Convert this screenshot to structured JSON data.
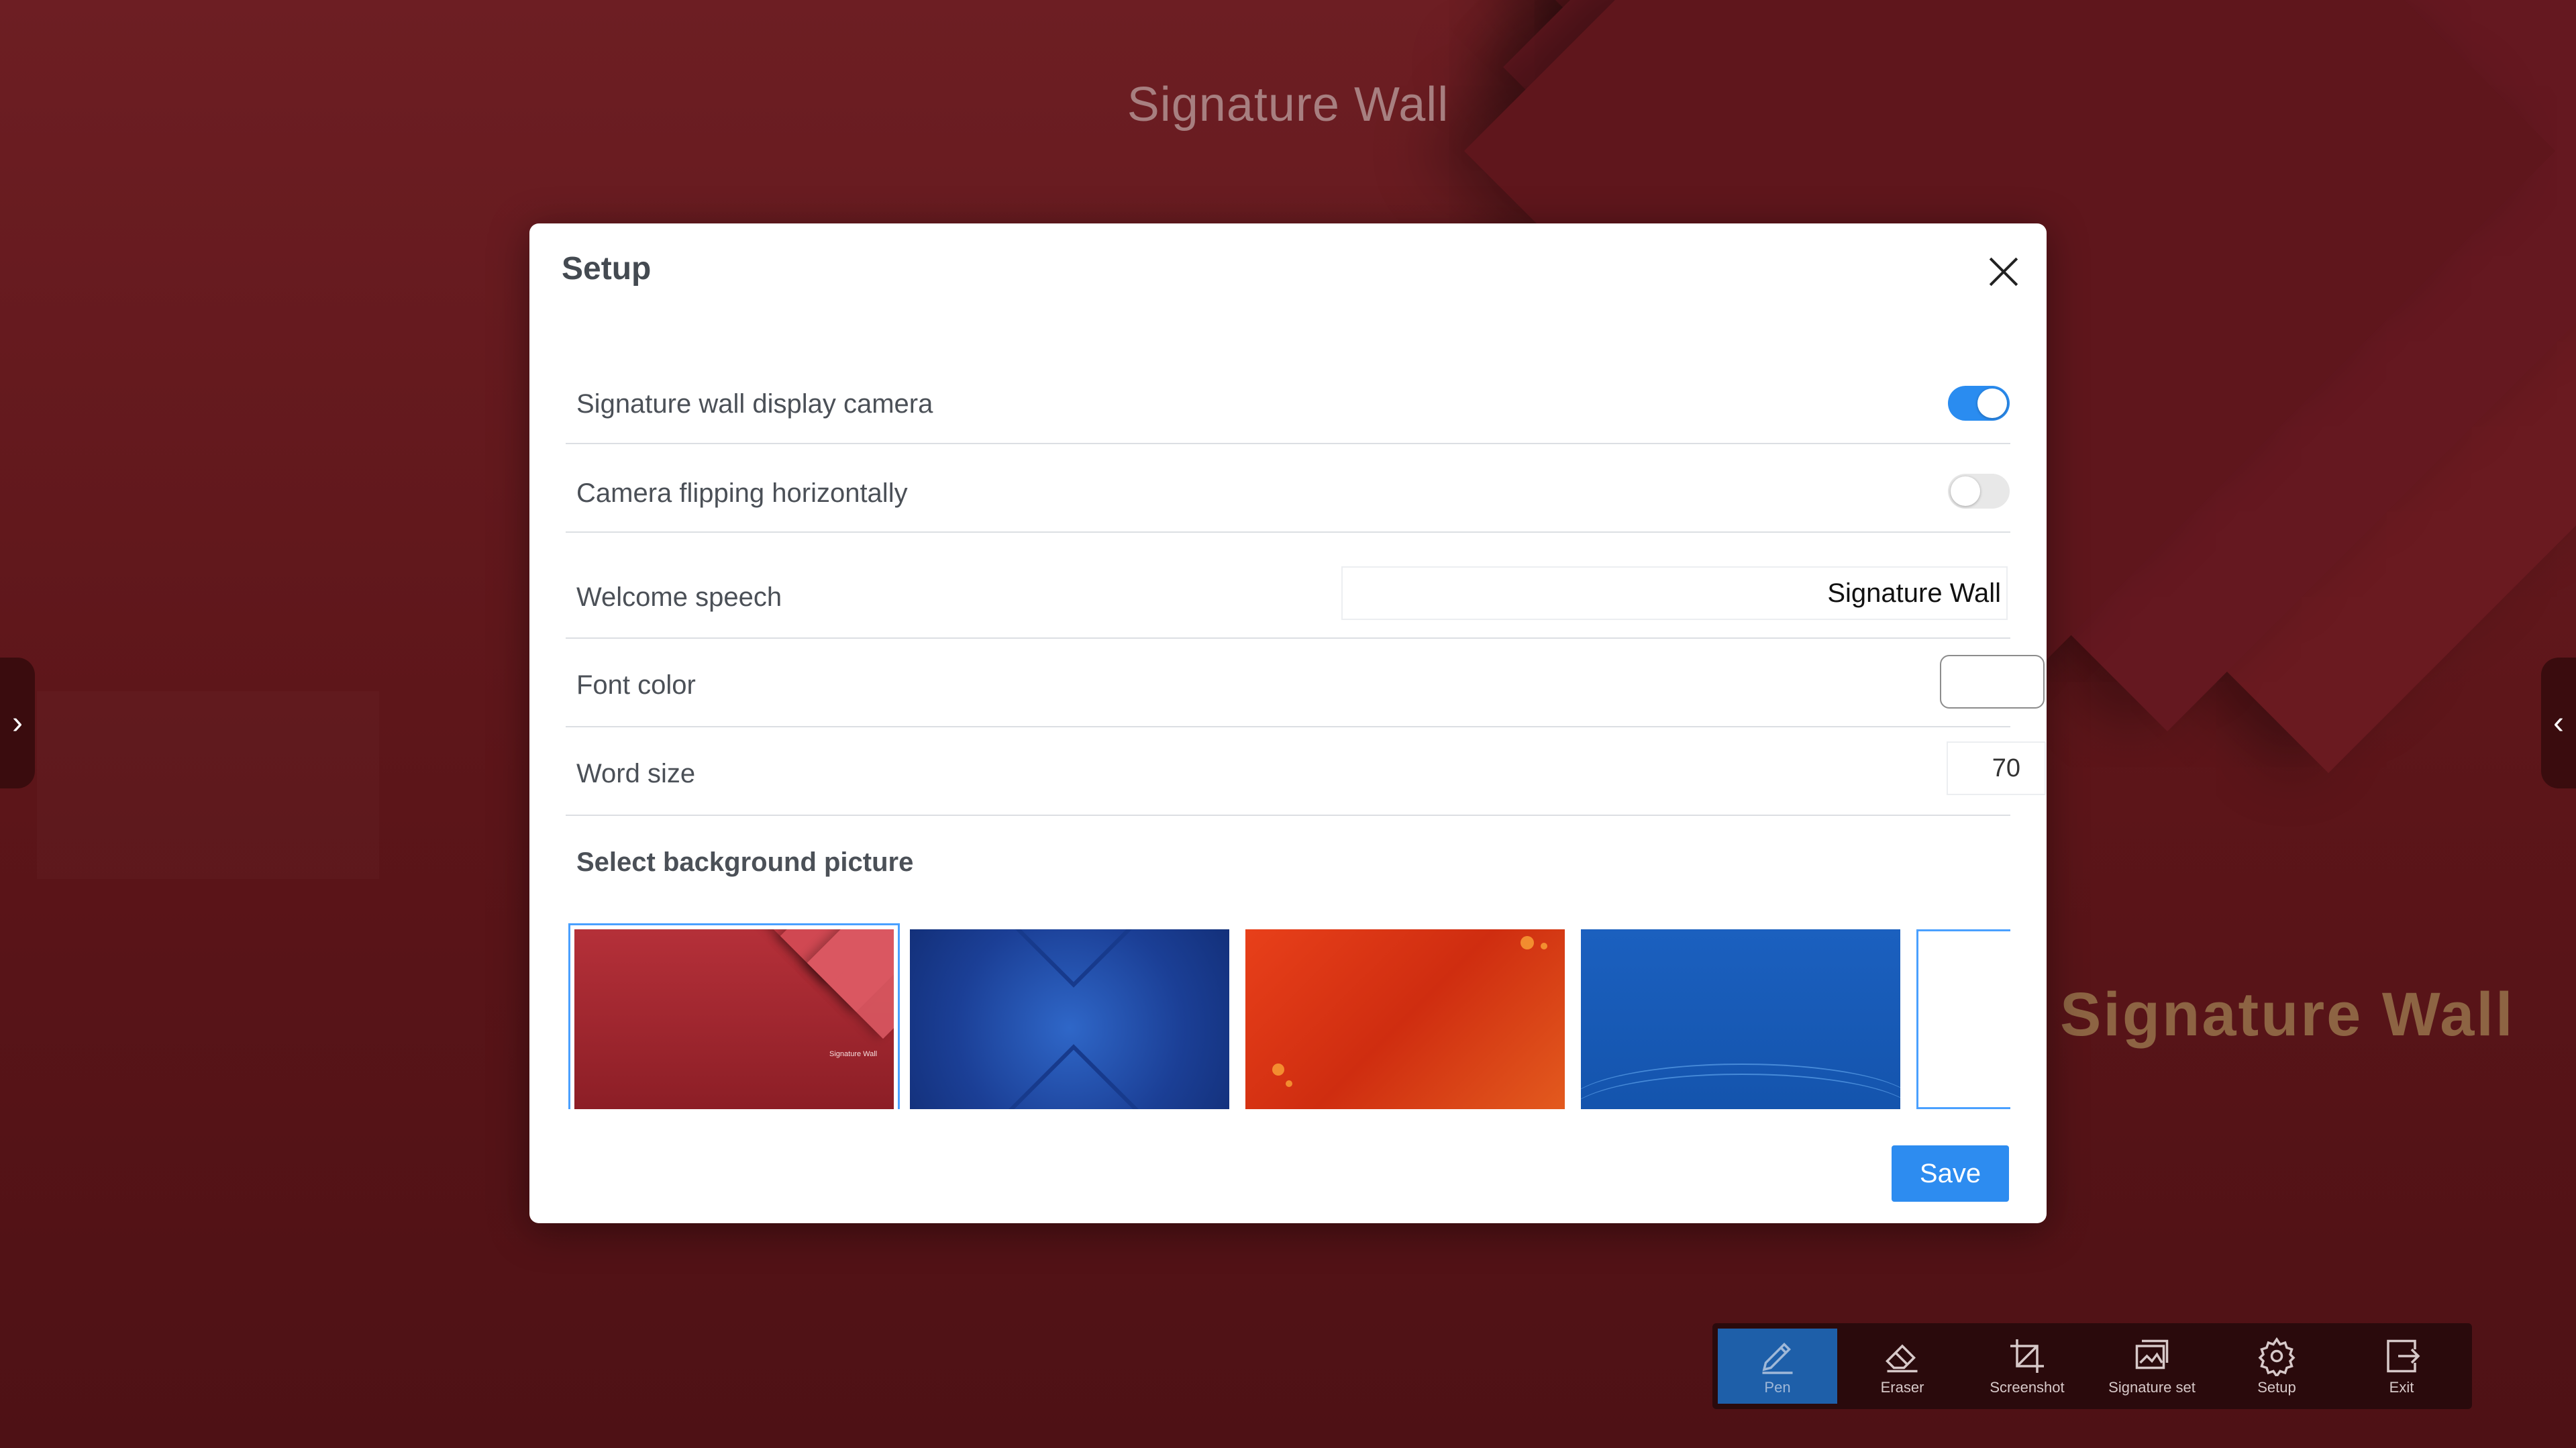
{
  "app": {
    "title": "Signature Wall",
    "watermark": "Signature Wall"
  },
  "dialog": {
    "title": "Setup",
    "settings": {
      "display_camera": {
        "label": "Signature wall display camera",
        "enabled": true
      },
      "flip_camera": {
        "label": "Camera flipping horizontally",
        "enabled": false
      },
      "welcome_speech": {
        "label": "Welcome speech",
        "value": "Signature Wall"
      },
      "font_color": {
        "label": "Font color",
        "value": "#ffffff"
      },
      "word_size": {
        "label": "Word size",
        "value": "70"
      }
    },
    "background_section": {
      "label": "Select background picture",
      "thumbnails": [
        {
          "name": "red-chevron",
          "selected": true,
          "caption": "Signature Wall"
        },
        {
          "name": "blue-chevron",
          "selected": false
        },
        {
          "name": "orange-silk",
          "selected": false
        },
        {
          "name": "blue-wave",
          "selected": false
        },
        {
          "name": "white",
          "selected": false
        }
      ]
    },
    "save_label": "Save"
  },
  "toolbar": {
    "tools": [
      {
        "label": "Pen",
        "icon": "pen-icon",
        "active": true
      },
      {
        "label": "Eraser",
        "icon": "eraser-icon",
        "active": false
      },
      {
        "label": "Screenshot",
        "icon": "crop-icon",
        "active": false
      },
      {
        "label": "Signature set",
        "icon": "gallery-icon",
        "active": false
      },
      {
        "label": "Setup",
        "icon": "gear-icon",
        "active": false
      },
      {
        "label": "Exit",
        "icon": "exit-icon",
        "active": false
      }
    ]
  },
  "colors": {
    "accent": "#2d8cf0",
    "background": "#5c1519",
    "toolbar": "#2a0a0c"
  }
}
